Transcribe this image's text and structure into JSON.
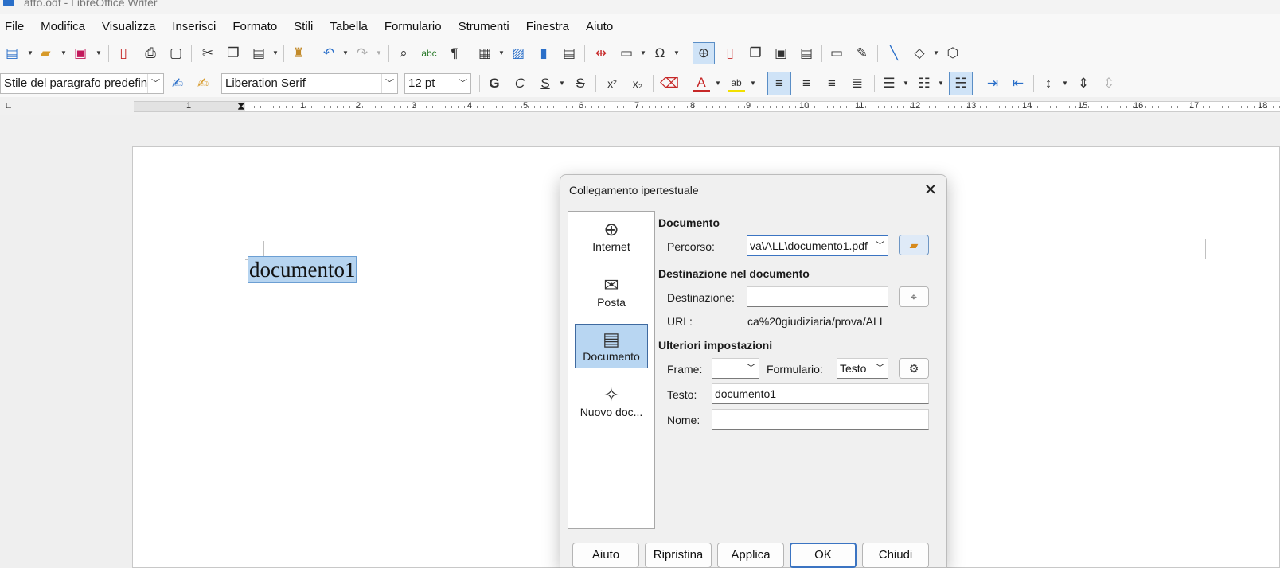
{
  "window": {
    "title": "atto.odt - LibreOffice Writer"
  },
  "menubar": {
    "items": [
      "File",
      "Modifica",
      "Visualizza",
      "Inserisci",
      "Formato",
      "Stili",
      "Tabella",
      "Formulario",
      "Strumenti",
      "Finestra",
      "Aiuto"
    ]
  },
  "toolbar2": {
    "paragraph_style": "Stile del paragrafo predefini",
    "font_name": "Liberation Serif",
    "font_size": "12 pt",
    "bold_label": "G",
    "italic_label": "C",
    "underline_label": "S",
    "strike_label": "S"
  },
  "ruler": {
    "numbers": [
      "1",
      "1",
      "2",
      "3",
      "4",
      "5",
      "6",
      "7",
      "8",
      "9",
      "10",
      "11",
      "12",
      "13",
      "14",
      "15",
      "16",
      "17",
      "18"
    ]
  },
  "document": {
    "selected_text": "documento1"
  },
  "dialog": {
    "title": "Collegamento ipertestuale",
    "sidebar": {
      "internet": "Internet",
      "mail": "Posta",
      "document": "Documento",
      "new_document": "Nuovo doc..."
    },
    "document_section": {
      "heading": "Documento",
      "path_label": "Percorso:",
      "path_value": "va\\ALL\\documento1.pdf"
    },
    "target_section": {
      "heading": "Destinazione nel documento",
      "target_label": "Destinazione:",
      "target_value": "",
      "url_label": "URL:",
      "url_value": "ca%20giudiziaria/prova/ALI"
    },
    "more_section": {
      "heading": "Ulteriori impostazioni",
      "frame_label": "Frame:",
      "frame_value": "",
      "form_label": "Formulario:",
      "form_value": "Testo",
      "text_label": "Testo:",
      "text_value": "documento1",
      "name_label": "Nome:",
      "name_value": ""
    },
    "buttons": {
      "help": "Aiuto",
      "reset": "Ripristina",
      "apply": "Applica",
      "ok": "OK",
      "close": "Chiudi"
    }
  }
}
